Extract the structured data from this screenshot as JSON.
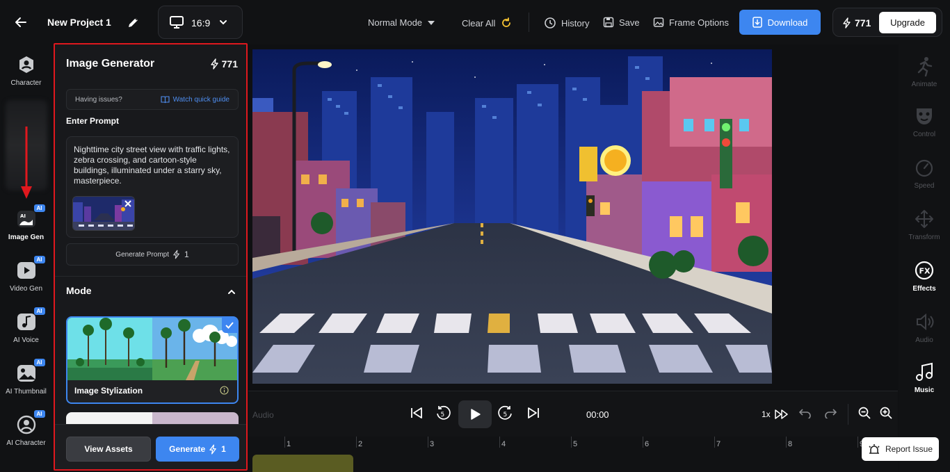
{
  "header": {
    "project_name": "New Project 1",
    "aspect_ratio": "16:9",
    "mode_selected": "Normal Mode",
    "clear_all": "Clear All",
    "history": "History",
    "save": "Save",
    "frame_options": "Frame Options",
    "download": "Download",
    "credits": "771",
    "upgrade": "Upgrade"
  },
  "left_rail": {
    "items": [
      {
        "label": "Character",
        "icon": "character-icon"
      },
      {
        "label": "Image Gen",
        "icon": "image-gen-icon",
        "badge": "AI",
        "active": true
      },
      {
        "label": "Video Gen",
        "icon": "video-gen-icon",
        "badge": "AI"
      },
      {
        "label": "AI Voice",
        "icon": "music-note-icon",
        "badge": "AI"
      },
      {
        "label": "AI Thumbnail",
        "icon": "thumbnail-icon",
        "badge": "AI"
      },
      {
        "label": "AI Character",
        "icon": "user-circle-icon",
        "badge": "AI"
      }
    ]
  },
  "panel": {
    "title": "Image Generator",
    "credits": "771",
    "issue_text": "Having issues?",
    "guide_link": "Watch quick guide",
    "prompt_label": "Enter Prompt",
    "prompt_text": "Nighttime city street view with traffic lights, zebra crossing, and cartoon-style buildings, illuminated under a starry sky, masterpiece.",
    "generate_prompt": "Generate Prompt",
    "generate_prompt_cost": "1",
    "mode_label": "Mode",
    "mode_card_name": "Image Stylization",
    "view_assets": "View Assets",
    "generate": "Generate",
    "generate_cost": "1"
  },
  "right_rail": {
    "items": [
      {
        "label": "Animate",
        "enabled": false
      },
      {
        "label": "Control",
        "enabled": false
      },
      {
        "label": "Speed",
        "enabled": false
      },
      {
        "label": "Transform",
        "enabled": false
      },
      {
        "label": "Effects",
        "enabled": true
      },
      {
        "label": "Audio",
        "enabled": false
      },
      {
        "label": "Music",
        "enabled": true
      }
    ]
  },
  "player": {
    "audio_label": "Audio",
    "time": "00:00",
    "speed": "1x",
    "skip_seconds": "5"
  },
  "timeline": {
    "ruler": [
      "1",
      "2",
      "3",
      "4",
      "5",
      "6",
      "7",
      "8",
      "9"
    ]
  },
  "report_issue": "Report Issue",
  "colors": {
    "accent": "#3d86f0",
    "highlight_border": "#e0181e",
    "background": "#111214"
  }
}
